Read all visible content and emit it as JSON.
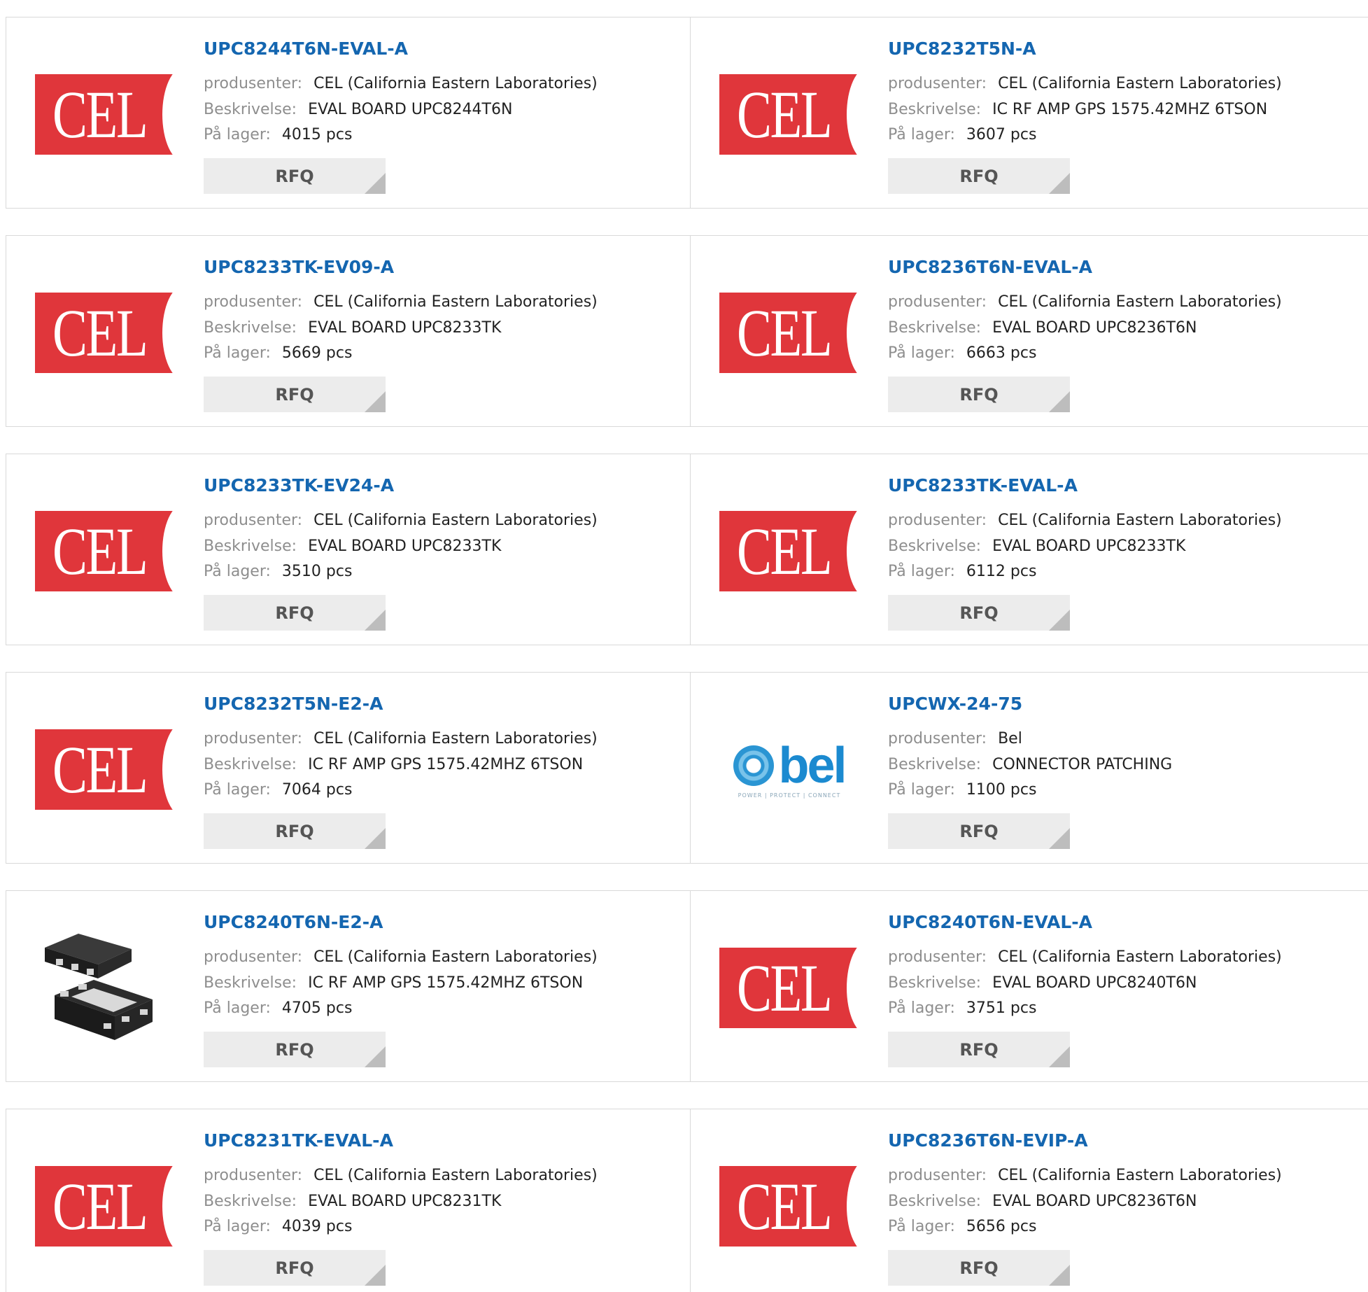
{
  "labels": {
    "manufacturer": "produsenter:",
    "description": "Beskrivelse:",
    "stock": "På lager:",
    "rfq": "RFQ"
  },
  "colors": {
    "title": "#1466b0",
    "cel_red": "#e0363b",
    "bel_blue": "#1b8ad0"
  },
  "products": [
    {
      "part": "UPC8244T6N-EVAL-A",
      "manufacturer": "CEL (California Eastern Laboratories)",
      "description": "EVAL BOARD UPC8244T6N",
      "stock": "4015 pcs",
      "logo": "CEL",
      "logo_type": "cel-logo"
    },
    {
      "part": "UPC8232T5N-A",
      "manufacturer": "CEL (California Eastern Laboratories)",
      "description": "IC RF AMP GPS 1575.42MHZ 6TSON",
      "stock": "3607 pcs",
      "logo": "CEL",
      "logo_type": "cel-logo"
    },
    {
      "part": "UPC8233TK-EV09-A",
      "manufacturer": "CEL (California Eastern Laboratories)",
      "description": "EVAL BOARD UPC8233TK",
      "stock": "5669 pcs",
      "logo": "CEL",
      "logo_type": "cel-logo"
    },
    {
      "part": "UPC8236T6N-EVAL-A",
      "manufacturer": "CEL (California Eastern Laboratories)",
      "description": "EVAL BOARD UPC8236T6N",
      "stock": "6663 pcs",
      "logo": "CEL",
      "logo_type": "cel-logo"
    },
    {
      "part": "UPC8233TK-EV24-A",
      "manufacturer": "CEL (California Eastern Laboratories)",
      "description": "EVAL BOARD UPC8233TK",
      "stock": "3510 pcs",
      "logo": "CEL",
      "logo_type": "cel-logo"
    },
    {
      "part": "UPC8233TK-EVAL-A",
      "manufacturer": "CEL (California Eastern Laboratories)",
      "description": "EVAL BOARD UPC8233TK",
      "stock": "6112 pcs",
      "logo": "CEL",
      "logo_type": "cel-logo"
    },
    {
      "part": "UPC8232T5N-E2-A",
      "manufacturer": "CEL (California Eastern Laboratories)",
      "description": "IC RF AMP GPS 1575.42MHZ 6TSON",
      "stock": "7064 pcs",
      "logo": "CEL",
      "logo_type": "cel-logo"
    },
    {
      "part": "UPCWX-24-75",
      "manufacturer": "Bel",
      "description": "CONNECTOR PATCHING",
      "stock": "1100 pcs",
      "logo": "bel",
      "logo_tagline": "POWER | PROTECT | CONNECT",
      "logo_type": "bel-logo"
    },
    {
      "part": "UPC8240T6N-E2-A",
      "manufacturer": "CEL (California Eastern Laboratories)",
      "description": "IC RF AMP GPS 1575.42MHZ 6TSON",
      "stock": "4705 pcs",
      "logo": "",
      "logo_type": "chip-package-image"
    },
    {
      "part": "UPC8240T6N-EVAL-A",
      "manufacturer": "CEL (California Eastern Laboratories)",
      "description": "EVAL BOARD UPC8240T6N",
      "stock": "3751 pcs",
      "logo": "CEL",
      "logo_type": "cel-logo"
    },
    {
      "part": "UPC8231TK-EVAL-A",
      "manufacturer": "CEL (California Eastern Laboratories)",
      "description": "EVAL BOARD UPC8231TK",
      "stock": "4039 pcs",
      "logo": "CEL",
      "logo_type": "cel-logo"
    },
    {
      "part": "UPC8236T6N-EVIP-A",
      "manufacturer": "CEL (California Eastern Laboratories)",
      "description": "EVAL BOARD UPC8236T6N",
      "stock": "5656 pcs",
      "logo": "CEL",
      "logo_type": "cel-logo"
    }
  ]
}
